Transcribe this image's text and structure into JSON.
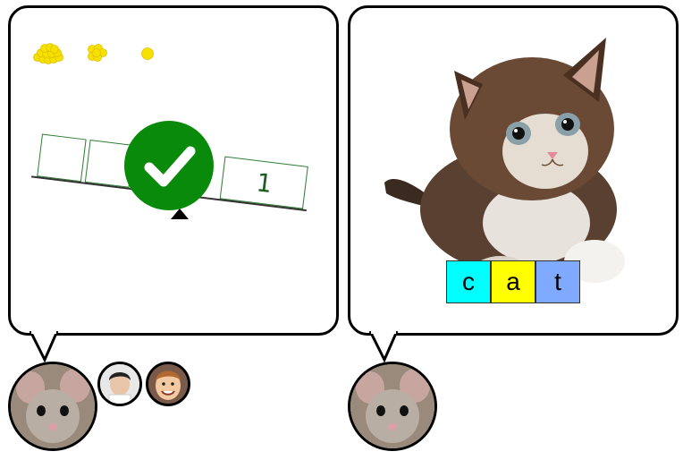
{
  "left_panel": {
    "counters": [
      "pile-of-coins-icon",
      "cluster-of-coins-icon",
      "single-coin-icon"
    ],
    "balance_boxes": [
      "",
      "",
      "",
      "1"
    ],
    "check_icon": "checkmark-icon",
    "colors": {
      "accent_green": "#0a8a0a",
      "box_border": "#2e7d32",
      "coin": "#f5e000"
    }
  },
  "right_panel": {
    "image": "kitten-photo",
    "letters": [
      {
        "char": "c",
        "color": "#00ffff"
      },
      {
        "char": "a",
        "color": "#ffff00"
      },
      {
        "char": "t",
        "color": "#7faaff"
      }
    ]
  },
  "avatars": {
    "left_speaker": "mouse-avatar",
    "participants": [
      "boy-avatar",
      "smiling-boy-avatar"
    ],
    "right_speaker": "mouse-avatar"
  }
}
